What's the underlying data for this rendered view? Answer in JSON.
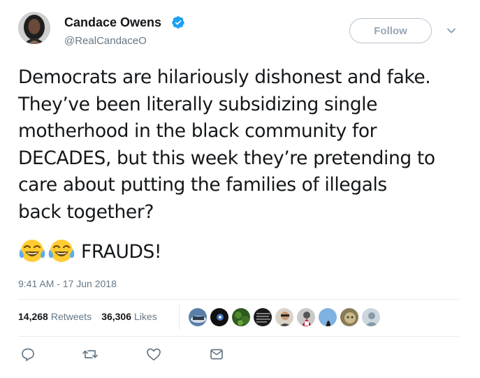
{
  "author": {
    "display_name": "Candace Owens",
    "handle": "@RealCandaceO",
    "verified": true,
    "avatar_icon": "profile-photo"
  },
  "header": {
    "follow_label": "Follow",
    "menu_icon": "chevron-down-icon"
  },
  "tweet": {
    "lines": [
      "Democrats are hilariously dishonest and fake.",
      "They’ve been literally subsidizing single",
      "motherhood in the black community for",
      "DECADES, but this week they’re pretending to",
      "care about putting the families of illegals",
      "back together?"
    ],
    "emoji": [
      "face-with-tears-of-joy",
      "face-with-tears-of-joy"
    ],
    "closing_text": "FRAUDS!",
    "timestamp": "9:41 AM - 17 Jun 2018"
  },
  "stats": {
    "retweets_count": "14,268",
    "retweets_label": "Retweets",
    "likes_count": "36,306",
    "likes_label": "Likes"
  },
  "likers": [
    {
      "icon": "liker-avatar-1"
    },
    {
      "icon": "liker-avatar-2"
    },
    {
      "icon": "liker-avatar-3"
    },
    {
      "icon": "liker-avatar-4"
    },
    {
      "icon": "liker-avatar-5"
    },
    {
      "icon": "liker-avatar-6"
    },
    {
      "icon": "liker-avatar-7"
    },
    {
      "icon": "liker-avatar-8"
    },
    {
      "icon": "liker-avatar-9"
    }
  ],
  "actions": [
    "reply-icon",
    "retweet-icon",
    "like-heart-icon",
    "direct-message-icon"
  ],
  "colors": {
    "verified_blue": "#1da1f2",
    "secondary_text": "#657786",
    "primary_text": "#14171a",
    "follow_border": "#b8c4cf"
  }
}
